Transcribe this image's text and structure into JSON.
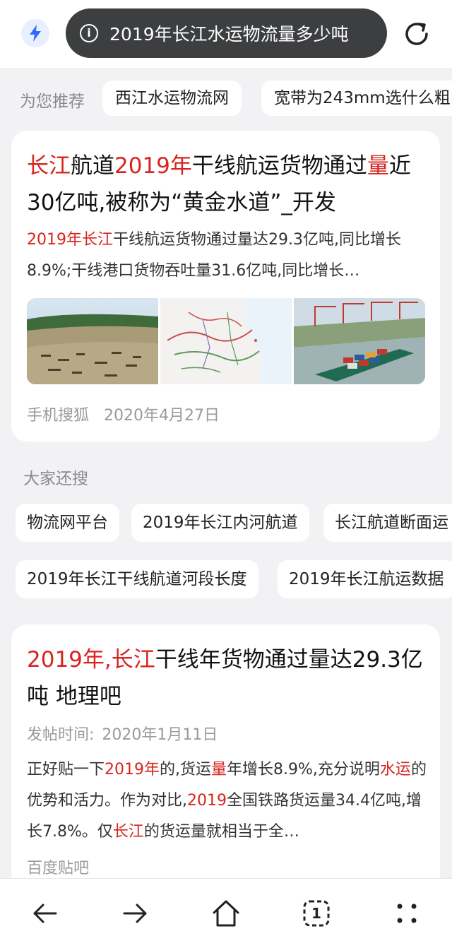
{
  "search": {
    "query": "2019年长江水运物流量多少吨",
    "info_glyph": "i"
  },
  "recommend": {
    "label": "为您推荐",
    "chips": [
      "西江水运物流网",
      "宽带为243mm选什么粗"
    ]
  },
  "result1": {
    "title": [
      {
        "t": "长江",
        "hl": true
      },
      {
        "t": "航道",
        "hl": false
      },
      {
        "t": "2019年",
        "hl": true
      },
      {
        "t": "干线航运货物通过",
        "hl": false
      },
      {
        "t": "量",
        "hl": true
      },
      {
        "t": "近30亿吨,被称为“黄金水道”_开发",
        "hl": false
      }
    ],
    "snippet": [
      {
        "t": "2019年长江",
        "hl": true
      },
      {
        "t": "干线航运货物通过量达29.3亿吨,同比增长8.9%;干线港口货物吞吐量31.6亿吨,同比增长…",
        "hl": false
      }
    ],
    "images": [
      "river-aerial-photo",
      "river-network-map",
      "container-ship-port-photo"
    ],
    "source": "手机搜狐",
    "date": "2020年4月27日"
  },
  "also_searched": {
    "label": "大家还搜",
    "chips": [
      "物流网平台",
      "2019年长江内河航道",
      "长江航道断面运",
      "2019年长江干线航道河段长度",
      "2019年长江航运数据"
    ]
  },
  "result2": {
    "title": [
      {
        "t": "2019年,长江",
        "hl": true
      },
      {
        "t": "干线年货物通过量达29.3亿吨 地理吧",
        "hl": false
      }
    ],
    "post_label": "发帖时间:",
    "post_date": "2020年1月11日",
    "snippet": [
      {
        "t": "正好贴一下",
        "hl": false
      },
      {
        "t": "2019年",
        "hl": true
      },
      {
        "t": "的,货运",
        "hl": false
      },
      {
        "t": "量",
        "hl": true
      },
      {
        "t": "年增长8.9%,充分说明",
        "hl": false
      },
      {
        "t": "水运",
        "hl": true
      },
      {
        "t": "的优势和活力。作为对比,",
        "hl": false
      },
      {
        "t": "2019",
        "hl": true
      },
      {
        "t": "全国铁路货运量34.4亿吨,增长7.8%。仅",
        "hl": false
      },
      {
        "t": "长江",
        "hl": true
      },
      {
        "t": "的货运量就相当于全…",
        "hl": false
      }
    ],
    "source": "百度贴吧"
  },
  "bottom_nav": {
    "tab_count": "1",
    "icons": [
      "back-arrow-icon",
      "forward-arrow-icon",
      "home-icon",
      "tabs-icon",
      "more-icon"
    ]
  },
  "colors": {
    "highlight": "#d8241f",
    "accent_blue": "#2f6bff",
    "pill_bg": "#3d3e40",
    "page_bg": "#f2f2f4"
  }
}
